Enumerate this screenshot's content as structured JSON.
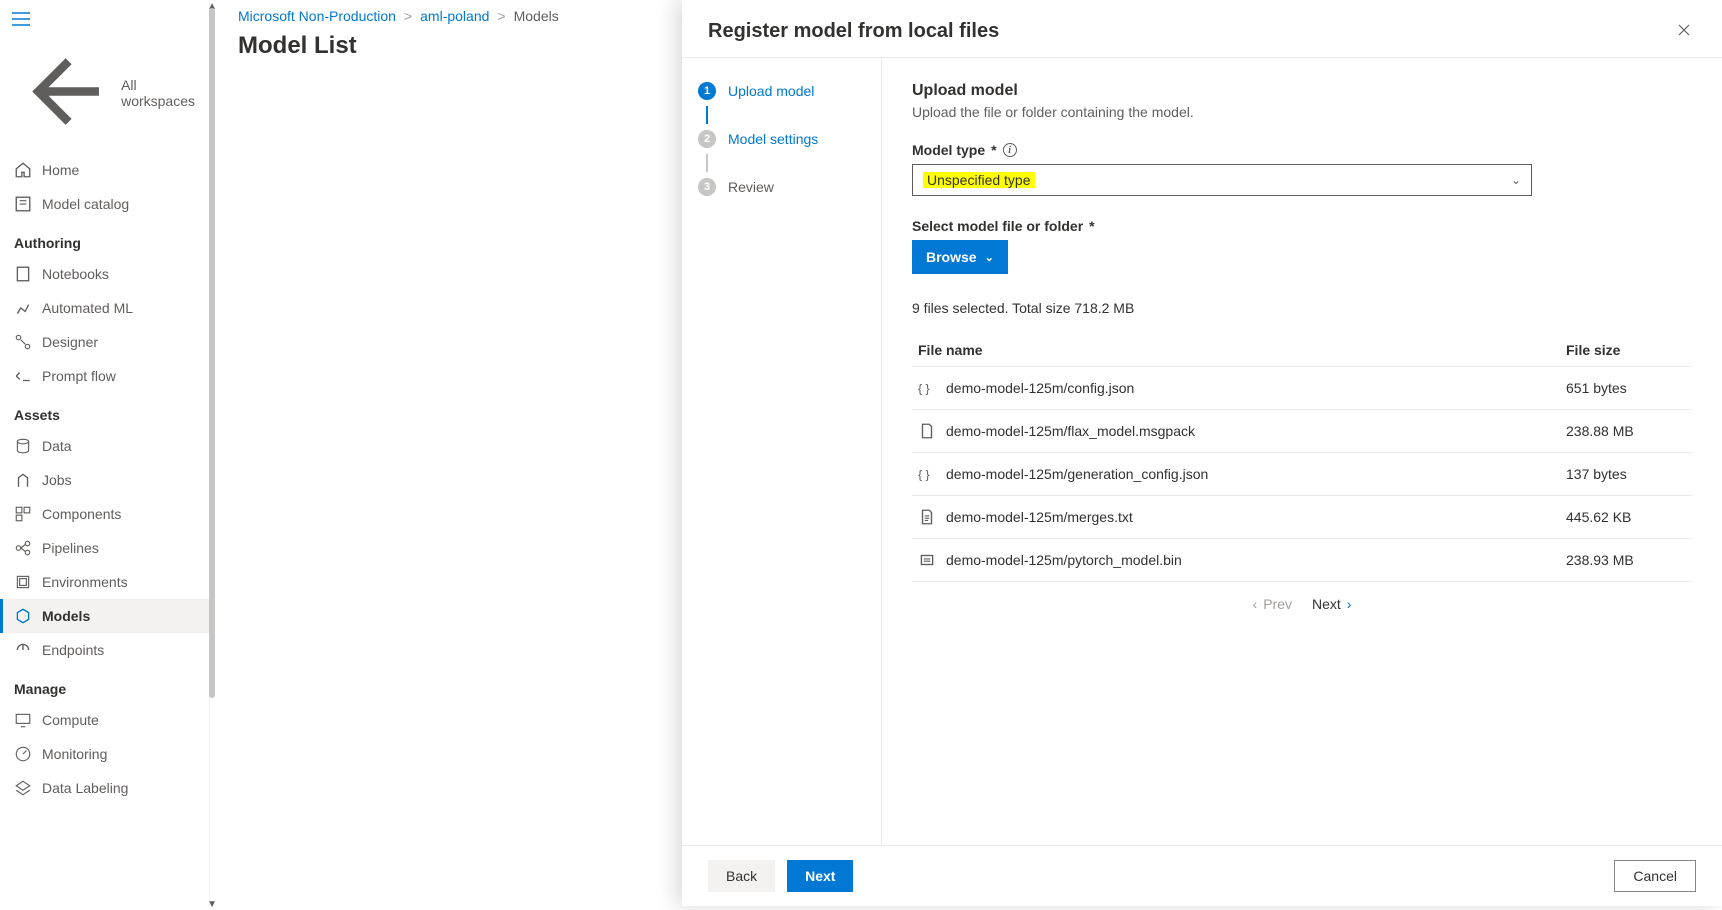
{
  "sidebar": {
    "all_workspaces": "All workspaces",
    "home": "Home",
    "model_catalog": "Model catalog",
    "sections": {
      "authoring": "Authoring",
      "assets": "Assets",
      "manage": "Manage"
    },
    "notebooks": "Notebooks",
    "automated_ml": "Automated ML",
    "designer": "Designer",
    "prompt_flow": "Prompt flow",
    "data": "Data",
    "jobs": "Jobs",
    "components": "Components",
    "pipelines": "Pipelines",
    "environments": "Environments",
    "models": "Models",
    "endpoints": "Endpoints",
    "compute": "Compute",
    "monitoring": "Monitoring",
    "data_labeling": "Data Labeling"
  },
  "breadcrumb": {
    "lvl1": "Microsoft Non-Production",
    "lvl2": "aml-poland",
    "lvl3": "Models"
  },
  "page_title": "Model List",
  "panel": {
    "title": "Register model from local files",
    "steps": {
      "s1": "Upload model",
      "s2": "Model settings",
      "s3": "Review"
    },
    "heading": "Upload model",
    "description": "Upload the file or folder containing the model.",
    "model_type_label": "Model type",
    "model_type_value": "Unspecified type",
    "select_file_label": "Select model file or folder",
    "browse": "Browse",
    "summary": "9 files selected. Total size 718.2 MB",
    "col_name": "File name",
    "col_size": "File size",
    "files": [
      {
        "icon": "json",
        "name": "demo-model-125m/config.json",
        "size": "651 bytes"
      },
      {
        "icon": "file",
        "name": "demo-model-125m/flax_model.msgpack",
        "size": "238.88 MB"
      },
      {
        "icon": "json",
        "name": "demo-model-125m/generation_config.json",
        "size": "137 bytes"
      },
      {
        "icon": "text",
        "name": "demo-model-125m/merges.txt",
        "size": "445.62 KB"
      },
      {
        "icon": "bin",
        "name": "demo-model-125m/pytorch_model.bin",
        "size": "238.93 MB"
      }
    ],
    "prev": "Prev",
    "next": "Next",
    "back_btn": "Back",
    "next_btn": "Next",
    "cancel_btn": "Cancel"
  }
}
